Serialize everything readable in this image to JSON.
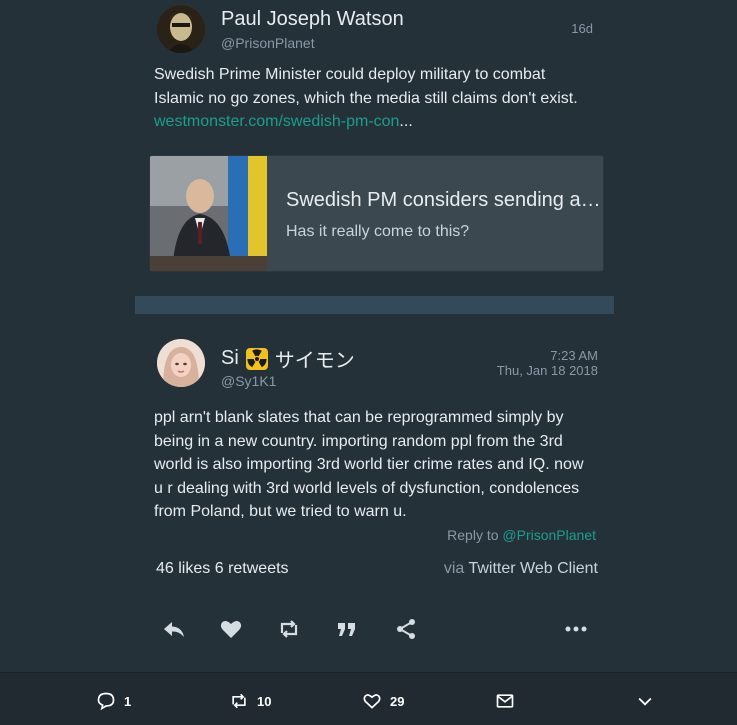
{
  "tweet1": {
    "name": "Paul Joseph Watson",
    "handle": "@PrisonPlanet",
    "age": "16d",
    "text_line1": "Swedish Prime Minister could deploy military to combat",
    "text_line2": "Islamic no go zones, which the media still claims don't exist.",
    "link_text": "westmonster.com/swedish-pm-con",
    "link_ellipsis": "...",
    "card": {
      "title": "Swedish PM considers sending a…",
      "description": "Has it really come to this?"
    }
  },
  "tweet2": {
    "name_prefix": "Si",
    "name_suffix": "サイモン",
    "handle": "@Sy1K1",
    "time": "7:23 AM",
    "date": "Thu, Jan 18 2018",
    "text": "ppl arn't blank slates that can be reprogrammed simply by being in a new country.  importing random ppl from the 3rd world is also importing 3rd world tier crime rates and IQ. now u r dealing with 3rd world levels of dysfunction, condolences from Poland, but we tried to warn u.",
    "reply_prefix": "Reply to",
    "reply_handle": "@PrisonPlanet",
    "likes_count": "46",
    "likes_label": "likes",
    "retweets_count": "6",
    "retweets_label": "retweets",
    "via_prefix": "via",
    "via_client": "Twitter Web Client",
    "actions": [
      "reply-icon",
      "heart-icon",
      "retweet-icon",
      "quote-icon",
      "share-icon",
      "more-icon"
    ]
  },
  "bottom_bar": {
    "replies": "1",
    "retweets": "10",
    "likes": "29"
  },
  "colors": {
    "background": "#253138",
    "separator": "#324a59",
    "link": "#1b9e8e",
    "muted": "#8899a6",
    "card": "#3b4850"
  }
}
